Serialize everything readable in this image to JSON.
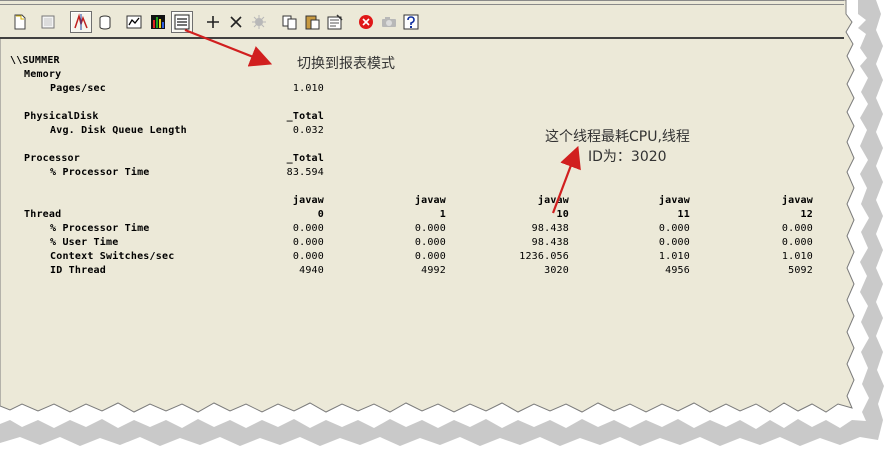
{
  "toolbar": {
    "icons": [
      "new-counter-set-icon",
      "clear-display-icon",
      "view-current-activity-icon",
      "view-log-data-icon",
      "view-graph-icon",
      "view-histogram-icon",
      "view-report-icon",
      "add-counter-icon",
      "delete-counter-icon",
      "highlight-icon",
      "copy-properties-icon",
      "paste-counter-list-icon",
      "properties-icon",
      "freeze-display-icon",
      "update-data-icon",
      "help-icon"
    ]
  },
  "report": {
    "computer": "\\\\SUMMER",
    "memory": {
      "object": "Memory",
      "counter": "Pages/sec",
      "value": "1.010"
    },
    "disk": {
      "object": "PhysicalDisk",
      "instance": "_Total",
      "counter": "Avg. Disk Queue Length",
      "value": "0.032"
    },
    "processor": {
      "object": "Processor",
      "instance": "_Total",
      "counter": "% Processor Time",
      "value": "83.594"
    },
    "thread": {
      "object": "Thread",
      "parents": [
        "javaw",
        "javaw",
        "javaw",
        "javaw",
        "javaw"
      ],
      "instances": [
        "0",
        "1",
        "10",
        "11",
        "12"
      ],
      "rows": [
        {
          "label": "% Processor Time",
          "values": [
            "0.000",
            "0.000",
            "98.438",
            "0.000",
            "0.000"
          ]
        },
        {
          "label": "% User Time",
          "values": [
            "0.000",
            "0.000",
            "98.438",
            "0.000",
            "0.000"
          ]
        },
        {
          "label": "Context Switches/sec",
          "values": [
            "0.000",
            "0.000",
            "1236.056",
            "1.010",
            "1.010"
          ]
        },
        {
          "label": "ID Thread",
          "values": [
            "4940",
            "4992",
            "3020",
            "4956",
            "5092"
          ]
        }
      ]
    }
  },
  "annotations": {
    "switch_report": "切换到报表模式",
    "cpu_line1": "这个线程最耗CPU,线程",
    "cpu_line2": "ID为：3020",
    "arrow_color": "#d11f1f"
  }
}
